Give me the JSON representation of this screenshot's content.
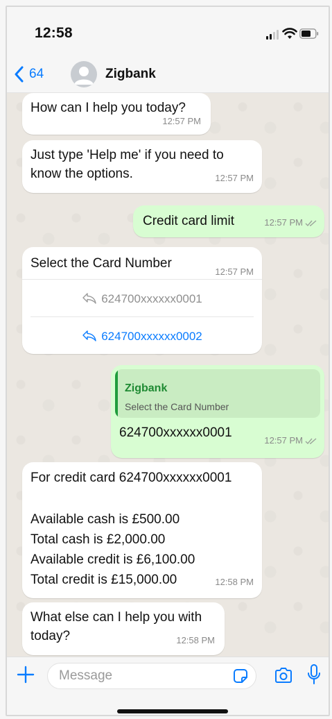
{
  "status_bar": {
    "time": "12:58"
  },
  "header": {
    "back_count": "64",
    "contact_name": "Zigbank"
  },
  "messages": {
    "m1": {
      "text": "How can I help you today?",
      "time": "12:57 PM"
    },
    "m2": {
      "text_line1": "Just type 'Help me' if you need to",
      "text_line2": "know the options.",
      "time": "12:57 PM"
    },
    "m3": {
      "text": "Credit card limit",
      "time": "12:57 PM"
    },
    "m4": {
      "text": "Select the Card Number",
      "time": "12:57 PM",
      "options": [
        "624700xxxxxx0001",
        "624700xxxxxx0002"
      ]
    },
    "m5": {
      "quote_author": "Zigbank",
      "quote_text": "Select the Card Number",
      "text": "624700xxxxxx0001",
      "time": "12:57 PM"
    },
    "m6": {
      "line1": "For credit card 624700xxxxxx0001",
      "line2": "Available cash is £500.00",
      "line3": "Total cash is £2,000.00",
      "line4": "Available credit is £6,100.00",
      "line5": "Total credit is £15,000.00",
      "time": "12:58 PM"
    },
    "m7": {
      "text_line1": "What else can I help you with",
      "text_line2": "today?",
      "time": "12:58 PM"
    }
  },
  "composer": {
    "placeholder": "Message"
  },
  "colors": {
    "incoming_bubble": "#ffffff",
    "outgoing_bubble": "#d8fdd2",
    "link_blue": "#0a7cff",
    "quote_green": "#1f8a33"
  },
  "icons": [
    "back-chevron",
    "avatar",
    "read-ticks",
    "reply-arrow",
    "plus",
    "sticker",
    "camera",
    "microphone"
  ]
}
